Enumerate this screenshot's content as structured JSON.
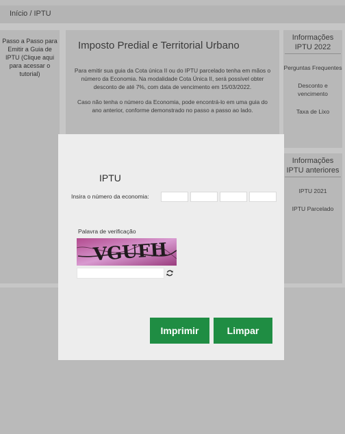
{
  "breadcrumb": {
    "home": "Início",
    "separator": "/",
    "current": "IPTU"
  },
  "left_sidebar": {
    "text": "Passo a Passo para Emitir a Guia de IPTU (Clique aqui para acessar o tutorial)"
  },
  "main": {
    "title": "Imposto Predial e Territorial Urbano",
    "paragraph1": "Para emitir sua guia da Cota única II ou do IPTU parcelado tenha em mãos o número da Economia. Na modalidade Cota Única II, será possível obter desconto de até 7%, com data de vencimento em 15/03/2022.",
    "paragraph2": "Caso não tenha o número da Economia, pode encontrá-lo em uma guia do ano anterior, conforme demonstrado no passo a passo ao lado."
  },
  "right_top": {
    "heading": "Informações IPTU 2022",
    "items": [
      "Perguntas Frequentes",
      "Desconto e vencimento",
      "Taxa de Lixo"
    ]
  },
  "right_bottom": {
    "heading": "Informações IPTU anteriores",
    "items": [
      "IPTU 2021",
      "IPTU Parcelado"
    ]
  },
  "modal": {
    "title": "IPTU",
    "economy_label": "Insira o número da economia:",
    "captcha_label": "Palavra de verificação",
    "captcha_text": "VGUFH",
    "print_button": "Imprimir",
    "clear_button": "Limpar"
  },
  "colors": {
    "primary_button": "#1f8d43",
    "modal_bg": "#ededed",
    "page_bg": "#c6c6c6"
  },
  "icons": {
    "captcha_refresh": "refresh-icon"
  }
}
